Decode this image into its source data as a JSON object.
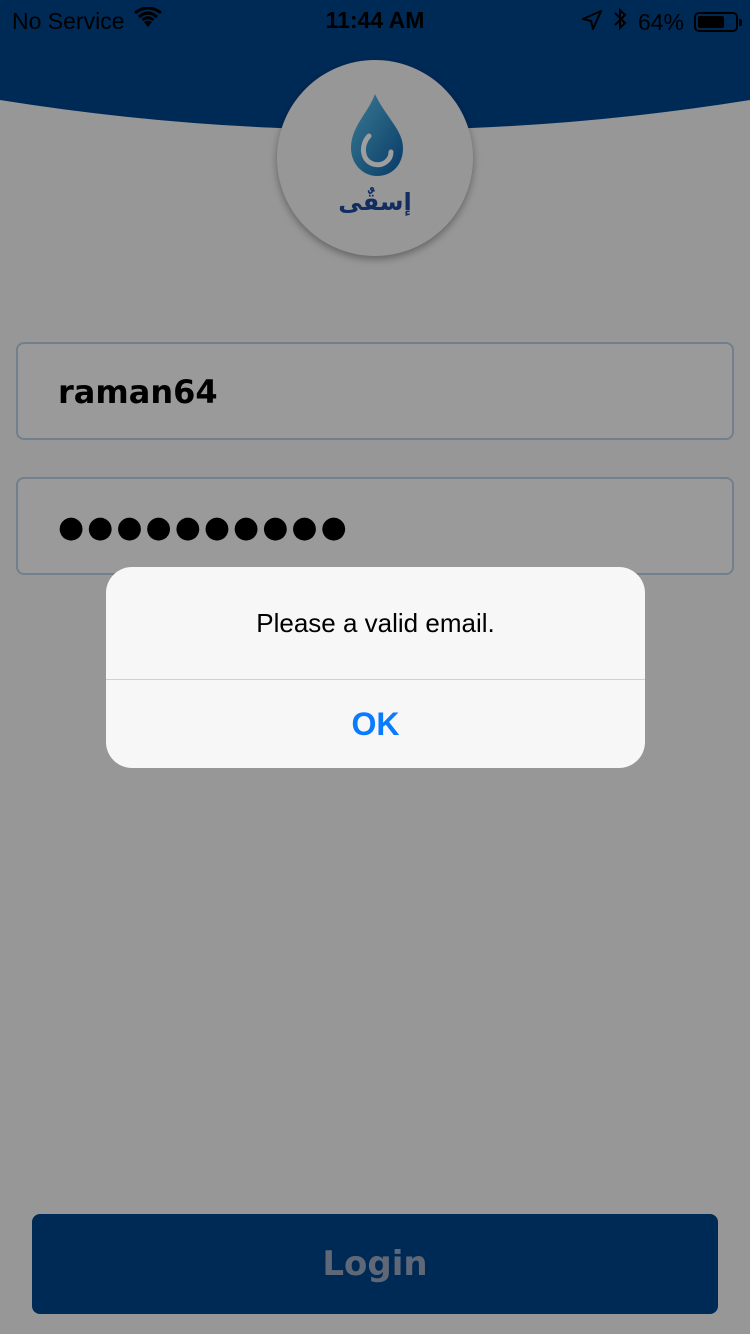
{
  "status_bar": {
    "carrier": "No Service",
    "time": "11:44 AM",
    "battery_percent": "64%",
    "battery_level": 0.64,
    "icons": [
      "wifi-icon",
      "location-arrow-icon",
      "bluetooth-icon",
      "battery-icon"
    ]
  },
  "logo": {
    "text": "إسقٌى",
    "icon": "water-drop-icon"
  },
  "form": {
    "username_value": "raman64",
    "password_masked": "●●●●●●●●●●"
  },
  "login_button_label": "Login",
  "alert": {
    "message": "Please a valid email.",
    "ok_label": "OK"
  },
  "colors": {
    "header_blue": "#00448c",
    "accent_blue": "#0a7aff",
    "logo_blue": "#1e4b9c"
  }
}
